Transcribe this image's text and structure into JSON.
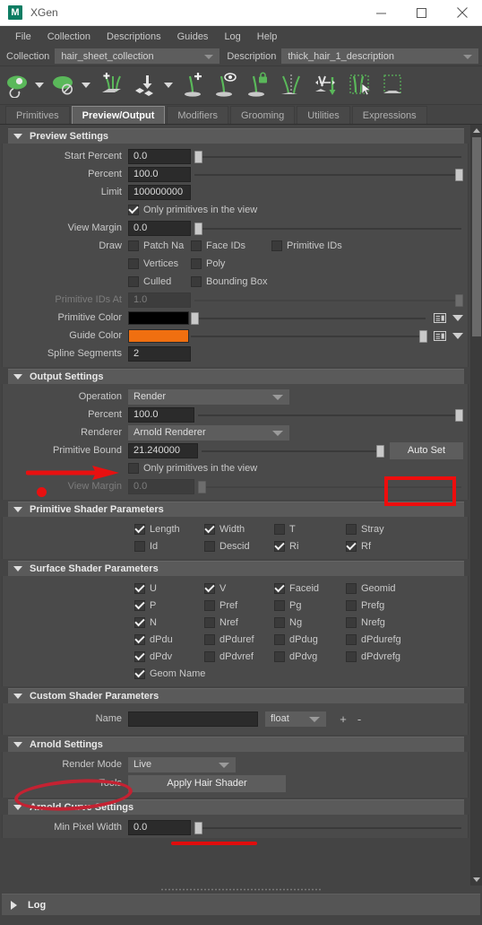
{
  "window": {
    "title": "XGen",
    "logo_text": "M",
    "minimize_label": "–",
    "maximize_label": "□",
    "close_label": "✕"
  },
  "menubar": {
    "items": [
      {
        "label": "File"
      },
      {
        "label": "Collection"
      },
      {
        "label": "Descriptions"
      },
      {
        "label": "Guides"
      },
      {
        "label": "Log"
      },
      {
        "label": "Help"
      }
    ]
  },
  "selector_row": {
    "collection_label": "Collection",
    "collection_value": "hair_sheet_collection",
    "description_label": "Description",
    "description_value": "thick_hair_1_description"
  },
  "toolbar": {
    "items": [
      {
        "name": "preview-eye-icon",
        "caret": true
      },
      {
        "name": "disable-preview-icon",
        "caret": true
      },
      {
        "name": "add-primitives-icon",
        "caret": false
      },
      {
        "name": "import-collection-icon",
        "caret": true
      },
      {
        "name": "add-guide-icon",
        "caret": false
      },
      {
        "name": "show-guide-icon",
        "caret": false
      },
      {
        "name": "lock-guide-icon",
        "caret": false
      },
      {
        "name": "mirror-guide-icon",
        "caret": false
      },
      {
        "name": "flip-guide-icon",
        "caret": false
      },
      {
        "name": "select-guides-icon",
        "caret": false
      },
      {
        "name": "select-region-icon",
        "caret": false
      }
    ]
  },
  "tabs": [
    {
      "label": "Primitives",
      "active": false
    },
    {
      "label": "Preview/Output",
      "active": true
    },
    {
      "label": "Modifiers",
      "active": false
    },
    {
      "label": "Grooming",
      "active": false
    },
    {
      "label": "Utilities",
      "active": false
    },
    {
      "label": "Expressions",
      "active": false
    }
  ],
  "preview_settings": {
    "title": "Preview Settings",
    "start_percent_label": "Start Percent",
    "start_percent_value": "0.0",
    "percent_label": "Percent",
    "percent_value": "100.0",
    "limit_label": "Limit",
    "limit_value": "100000000",
    "only_primitives_label": "Only primitives in the view",
    "view_margin_label": "View Margin",
    "view_margin_value": "0.0",
    "draw_label": "Draw",
    "draw_options": [
      {
        "label": "Patch Na",
        "checked": false
      },
      {
        "label": "Face IDs",
        "checked": false
      },
      {
        "label": "Primitive IDs",
        "checked": false
      },
      {
        "label": "Vertices",
        "checked": false
      },
      {
        "label": "Poly",
        "checked": false
      },
      {
        "label": "Culled",
        "checked": false
      },
      {
        "label": "Bounding Box",
        "checked": false
      }
    ],
    "primitive_ids_at_label": "Primitive IDs At",
    "primitive_ids_at_value": "1.0",
    "primitive_color_label": "Primitive Color",
    "primitive_color_value": "#000000",
    "guide_color_label": "Guide Color",
    "guide_color_value": "#F06F10",
    "spline_segments_label": "Spline Segments",
    "spline_segments_value": "2"
  },
  "output_settings": {
    "title": "Output Settings",
    "operation_label": "Operation",
    "operation_value": "Render",
    "percent_label": "Percent",
    "percent_value": "100.0",
    "renderer_label": "Renderer",
    "renderer_value": "Arnold Renderer",
    "primitive_bound_label": "Primitive Bound",
    "primitive_bound_value": "21.240000",
    "auto_set_label": "Auto Set",
    "only_primitives_label": "Only primitives in the view",
    "view_margin_label": "View Margin",
    "view_margin_value": "0.0"
  },
  "primitive_shader": {
    "title": "Primitive Shader Parameters",
    "row1": [
      {
        "label": "Length",
        "checked": true
      },
      {
        "label": "Width",
        "checked": true
      },
      {
        "label": "T",
        "checked": false
      },
      {
        "label": "Stray",
        "checked": false
      }
    ],
    "row2": [
      {
        "label": "Id",
        "checked": false
      },
      {
        "label": "Descid",
        "checked": false
      },
      {
        "label": "Ri",
        "checked": true
      },
      {
        "label": "Rf",
        "checked": true
      }
    ]
  },
  "surface_shader": {
    "title": "Surface Shader Parameters",
    "rows": [
      [
        {
          "label": "U",
          "checked": true
        },
        {
          "label": "V",
          "checked": true
        },
        {
          "label": "Faceid",
          "checked": true
        },
        {
          "label": "Geomid",
          "checked": false
        }
      ],
      [
        {
          "label": "P",
          "checked": true
        },
        {
          "label": "Pref",
          "checked": false
        },
        {
          "label": "Pg",
          "checked": false
        },
        {
          "label": "Prefg",
          "checked": false
        }
      ],
      [
        {
          "label": "N",
          "checked": true
        },
        {
          "label": "Nref",
          "checked": false
        },
        {
          "label": "Ng",
          "checked": false
        },
        {
          "label": "Nrefg",
          "checked": false
        }
      ],
      [
        {
          "label": "dPdu",
          "checked": true
        },
        {
          "label": "dPduref",
          "checked": false
        },
        {
          "label": "dPdug",
          "checked": false
        },
        {
          "label": "dPdurefg",
          "checked": false
        }
      ],
      [
        {
          "label": "dPdv",
          "checked": true
        },
        {
          "label": "dPdvref",
          "checked": false
        },
        {
          "label": "dPdvg",
          "checked": false
        },
        {
          "label": "dPdvrefg",
          "checked": false
        }
      ]
    ],
    "geom_name_label": "Geom Name",
    "geom_name_checked": true
  },
  "custom_shader": {
    "title": "Custom Shader Parameters",
    "name_label": "Name",
    "name_value": "",
    "type_value": "float",
    "add_label": "+",
    "remove_label": "-"
  },
  "arnold_settings": {
    "title": "Arnold Settings",
    "render_mode_label": "Render Mode",
    "render_mode_value": "Live",
    "tools_label": "Tools",
    "apply_hair_shader_label": "Apply Hair Shader"
  },
  "arnold_curve_settings": {
    "title": "Arnold Curve Settings",
    "min_pixel_width_label": "Min Pixel Width",
    "min_pixel_width_value": "0.0"
  },
  "log_bar": {
    "label": "Log"
  },
  "annotations": {
    "arrow_color": "#e81010",
    "dot_color": "#e81010",
    "rect_color": "#ee0d0d",
    "ellipse_color": "#c42232",
    "underline_color": "#e00d0d"
  }
}
